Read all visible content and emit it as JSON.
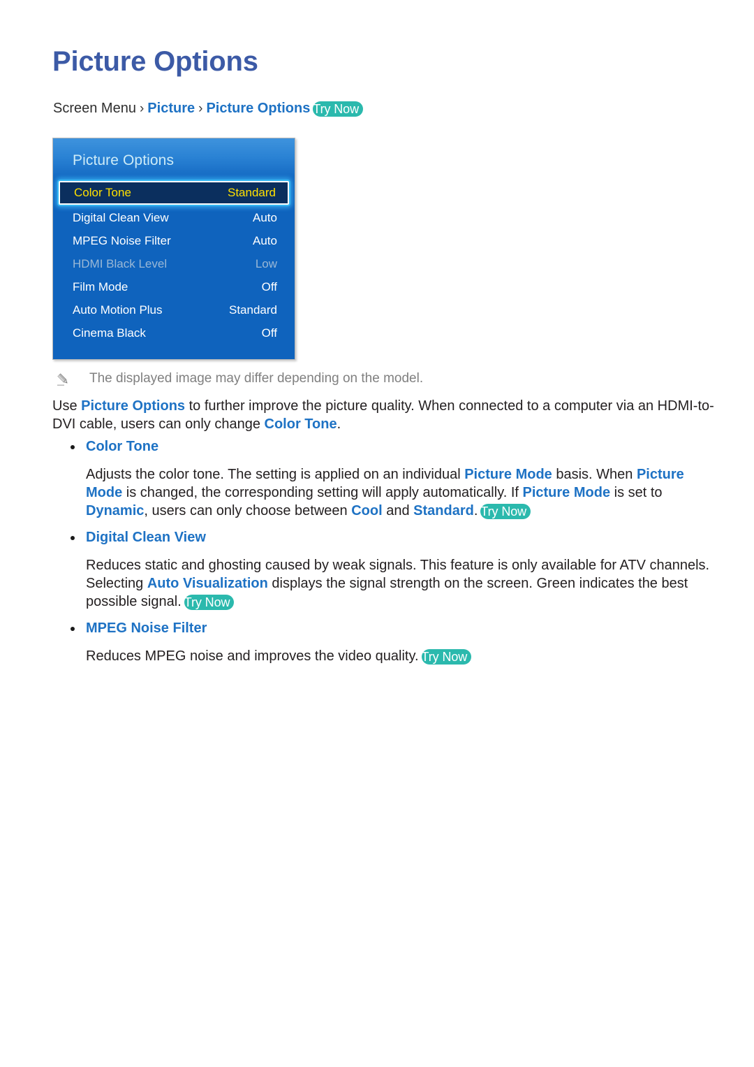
{
  "page": {
    "title": "Picture Options"
  },
  "breadcrumb": {
    "root": "Screen Menu",
    "separator": "›",
    "items": [
      "Picture",
      "Picture Options"
    ],
    "try_now": "Try Now"
  },
  "tv_panel": {
    "title": "Picture Options",
    "rows": [
      {
        "label": "Color Tone",
        "value": "Standard",
        "selected": true,
        "disabled": false
      },
      {
        "label": "Digital Clean View",
        "value": "Auto",
        "selected": false,
        "disabled": false
      },
      {
        "label": "MPEG Noise Filter",
        "value": "Auto",
        "selected": false,
        "disabled": false
      },
      {
        "label": "HDMI Black Level",
        "value": "Low",
        "selected": false,
        "disabled": true
      },
      {
        "label": "Film Mode",
        "value": "Off",
        "selected": false,
        "disabled": false
      },
      {
        "label": "Auto Motion Plus",
        "value": "Standard",
        "selected": false,
        "disabled": false
      },
      {
        "label": "Cinema Black",
        "value": "Off",
        "selected": false,
        "disabled": false
      }
    ],
    "colors": {
      "background": "#0f63bd",
      "header_top": "#3e93dd",
      "selected_fill": "#0b2f5e",
      "selected_text": "#ffe000",
      "glow": "#35b6f2",
      "title_text": "#cdebf7",
      "disabled_text": "#9ab8d6"
    }
  },
  "note": {
    "icon": "pencil-icon",
    "text": "The displayed image may differ depending on the model."
  },
  "intro": {
    "t1": "Use ",
    "hl1": "Picture Options",
    "t2": " to further improve the picture quality. When connected to a computer via an HDMI-to-DVI cable, users can only change ",
    "hl2": "Color Tone",
    "t3": "."
  },
  "sections": {
    "color_tone": {
      "heading": "Color Tone",
      "t1": "Adjusts the color tone. The setting is applied on an individual ",
      "hl1": "Picture Mode",
      "t2": " basis. When ",
      "hl2": "Picture Mode",
      "t3": " is changed, the corresponding setting will apply automatically. If ",
      "hl3": "Picture Mode",
      "t4": " is set to ",
      "hl4": "Dynamic",
      "t5": ", users can only choose between ",
      "hl5": "Cool",
      "t6": " and ",
      "hl6": "Standard",
      "t7": ".",
      "try_now": "Try Now"
    },
    "digital_clean_view": {
      "heading": "Digital Clean View",
      "t1": "Reduces static and ghosting caused by weak signals. This feature is only available for ATV channels. Selecting ",
      "hl1": "Auto Visualization",
      "t2": " displays the signal strength on the screen. Green indicates the best possible signal.",
      "try_now": "Try Now"
    },
    "mpeg_noise_filter": {
      "heading": "MPEG Noise Filter",
      "t1": "Reduces MPEG noise and improves the video quality.",
      "try_now": "Try Now"
    }
  },
  "colors": {
    "title": "#3c5aa6",
    "link": "#1e72c4",
    "badge": "#2bb9ad",
    "body_text": "#231f20",
    "note_text": "#808080"
  }
}
